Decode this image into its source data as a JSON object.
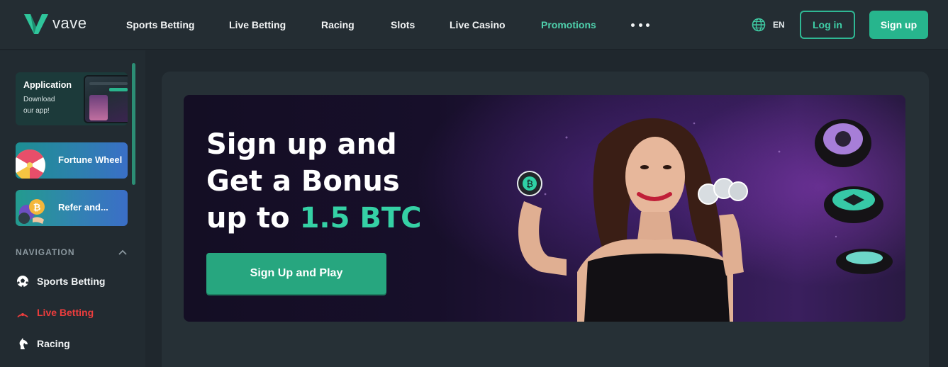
{
  "header": {
    "logo_text": "vave",
    "nav": [
      {
        "label": "Sports Betting"
      },
      {
        "label": "Live Betting"
      },
      {
        "label": "Racing"
      },
      {
        "label": "Slots"
      },
      {
        "label": "Live Casino"
      },
      {
        "label": "Promotions"
      }
    ],
    "more_icon": "ellipsis-icon",
    "language": {
      "icon": "globe-icon",
      "code": "EN"
    },
    "login_label": "Log in",
    "signup_label": "Sign up"
  },
  "sidebar": {
    "app_card": {
      "title": "Application",
      "subtitle": "Download our app!"
    },
    "promos": [
      {
        "label": "Fortune Wheel",
        "icon": "fortune-wheel-icon"
      },
      {
        "label": "Refer and...",
        "icon": "coins-icon"
      }
    ],
    "navigation_heading": "NAVIGATION",
    "nav_items": [
      {
        "label": "Sports Betting",
        "icon": "soccer-ball-icon"
      },
      {
        "label": "Live Betting",
        "icon": "live-signal-icon",
        "color": "#ee3d3d"
      },
      {
        "label": "Racing",
        "icon": "horse-icon"
      }
    ]
  },
  "banner": {
    "line1": "Sign up and",
    "line2": "Get a Bonus",
    "line3_prefix": "up to ",
    "line3_accent": "1.5 BTC",
    "cta": "Sign Up and Play"
  },
  "colors": {
    "accent": "#27b58d",
    "promo_nav": "#4fd1ad",
    "live": "#ee3d3d",
    "background": "#1f272d"
  }
}
